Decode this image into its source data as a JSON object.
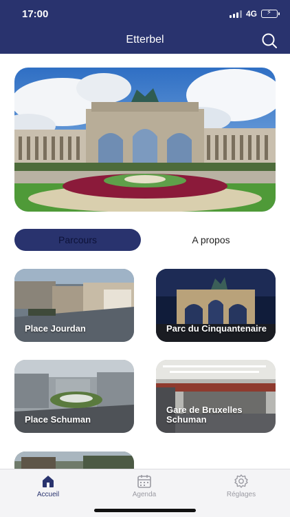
{
  "status_bar": {
    "time": "17:00",
    "network": "4G",
    "icons": [
      "signal-icon",
      "battery-charging-icon"
    ]
  },
  "header": {
    "title": "Etterbel",
    "search_icon": "search-icon"
  },
  "hero": {
    "image": "cinquantenaire-arch-photo"
  },
  "segments": {
    "active": "Parcours",
    "inactive": "A propos"
  },
  "cards": [
    {
      "label": "Place Jourdan",
      "image": "place-jourdan-photo"
    },
    {
      "label": "Parc du Cinquantenaire",
      "image": "cinquantenaire-night-photo"
    },
    {
      "label": "Place Schuman",
      "image": "place-schuman-photo"
    },
    {
      "label": "Gare de Bruxelles Schuman",
      "image": "gare-schuman-photo"
    },
    {
      "label": "",
      "image": "partial-street-photo"
    }
  ],
  "tabbar": {
    "items": [
      {
        "label": "Accueil",
        "icon": "home-icon",
        "active": true
      },
      {
        "label": "Agenda",
        "icon": "calendar-icon",
        "active": false
      },
      {
        "label": "Réglages",
        "icon": "gear-icon",
        "active": false
      }
    ]
  },
  "colors": {
    "primary": "#29336e",
    "tab_inactive": "#9a9aa2",
    "tabbar_bg": "#f4f4f6"
  }
}
